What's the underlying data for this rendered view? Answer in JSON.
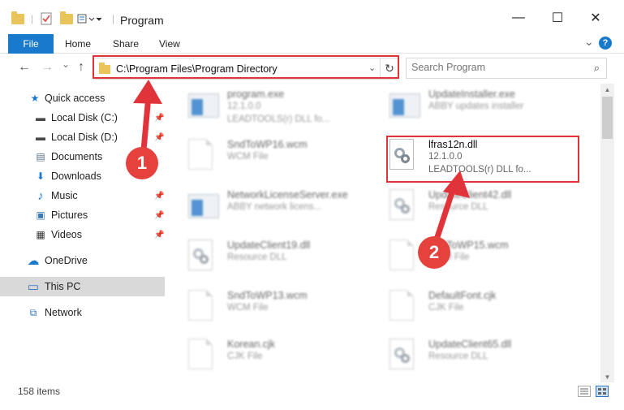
{
  "window": {
    "title": "Program",
    "minimize_glyph": "—",
    "maximize_glyph": "☐",
    "close_glyph": "✕"
  },
  "ribbon": {
    "tabs": [
      "File",
      "Home",
      "Share",
      "View"
    ],
    "expand_glyph": "⌄",
    "help_glyph": "?"
  },
  "navbar": {
    "back_glyph": "←",
    "forward_glyph": "→",
    "recent_glyph": "⌄",
    "up_glyph": "↑",
    "address_path": "C:\\Program Files\\Program Directory",
    "dropdown_glyph": "⌄",
    "refresh_glyph": "↻",
    "search_placeholder": "Search Program",
    "search_glyph": "⌕"
  },
  "sidebar": {
    "items": [
      {
        "label": "Quick access",
        "icon": "star-icon",
        "glyph": "★",
        "color": "#1979ca"
      },
      {
        "label": "Local Disk (C:)",
        "icon": "drive-icon",
        "glyph": "▬",
        "color": "#4a4a4a"
      },
      {
        "label": "Local Disk (D:)",
        "icon": "drive-icon",
        "glyph": "▬",
        "color": "#4a4a4a"
      },
      {
        "label": "Documents",
        "icon": "documents-icon",
        "glyph": "▤",
        "color": "#5a6f88"
      },
      {
        "label": "Downloads",
        "icon": "download-icon",
        "glyph": "⬇",
        "color": "#1979ca"
      },
      {
        "label": "Music",
        "icon": "music-icon",
        "glyph": "♪",
        "color": "#1979ca"
      },
      {
        "label": "Pictures",
        "icon": "pictures-icon",
        "glyph": "▣",
        "color": "#3d7ab8"
      },
      {
        "label": "Videos",
        "icon": "videos-icon",
        "glyph": "▦",
        "color": "#333"
      },
      {
        "label": "OneDrive",
        "icon": "cloud-icon",
        "glyph": "☁",
        "color": "#1979ca"
      },
      {
        "label": "This PC",
        "icon": "pc-icon",
        "glyph": "▭",
        "color": "#2b73c5"
      },
      {
        "label": "Network",
        "icon": "network-icon",
        "glyph": "⧉",
        "color": "#2b73c5"
      }
    ],
    "pin_glyph": "📌"
  },
  "files": [
    {
      "name": "program.exe",
      "line2": "12.1.0.0",
      "line3": "LEADTOOLS(r) DLL fo...",
      "icon": "exe-icon",
      "blurred": true
    },
    {
      "name": "UpdateInstaller.exe",
      "line2": "ABBY updates installer",
      "line3": "",
      "icon": "exe-icon",
      "blurred": true
    },
    {
      "name": "SndToWP16.wcm",
      "line2": "WCM File",
      "line3": "",
      "icon": "file-icon",
      "blurred": true
    },
    {
      "name": "lfras12n.dll",
      "line2": "12.1.0.0",
      "line3": "LEADTOOLS(r) DLL fo...",
      "icon": "dll-icon",
      "blurred": false
    },
    {
      "name": "NetworkLicenseServer.exe",
      "line2": "ABBY network licens...",
      "line3": "",
      "icon": "exe-icon",
      "blurred": true
    },
    {
      "name": "UpdateClient42.dll",
      "line2": "Resource DLL",
      "line3": "",
      "icon": "dll-icon",
      "blurred": true
    },
    {
      "name": "UpdateClient19.dll",
      "line2": "Resource DLL",
      "line3": "",
      "icon": "dll-icon",
      "blurred": true
    },
    {
      "name": "SndToWP15.wcm",
      "line2": "WCM File",
      "line3": "",
      "icon": "file-icon",
      "blurred": true
    },
    {
      "name": "SndToWP13.wcm",
      "line2": "WCM File",
      "line3": "",
      "icon": "file-icon",
      "blurred": true
    },
    {
      "name": "DefaultFont.cjk",
      "line2": "CJK File",
      "line3": "",
      "icon": "file-icon",
      "blurred": true
    },
    {
      "name": "Korean.cjk",
      "line2": "CJK File",
      "line3": "",
      "icon": "file-icon",
      "blurred": true
    },
    {
      "name": "UpdateClient65.dll",
      "line2": "Resource DLL",
      "line3": "",
      "icon": "dll-icon",
      "blurred": true
    }
  ],
  "status": {
    "item_count": "158 items"
  },
  "annotations": {
    "badge1": "1",
    "badge2": "2",
    "color": "#e0343a"
  }
}
